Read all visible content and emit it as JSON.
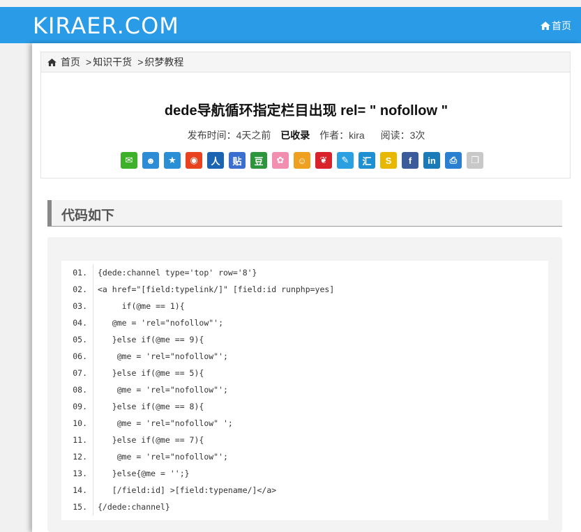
{
  "header": {
    "logo": "KIRAER.COM",
    "home_label": "首页"
  },
  "breadcrumb": {
    "home": "首页",
    "sep1": ">",
    "cat1": "知识干货",
    "sep2": ">",
    "cat2": "织梦教程"
  },
  "article": {
    "title": "dede导航循环指定栏目出现 rel= \" nofollow \"",
    "publish_label": "发布时间：",
    "publish_value": "4天之前",
    "indexed": "已收录",
    "author_label": "作者：",
    "author": "kira",
    "reads_label": "阅读：",
    "reads": "3次"
  },
  "share_icons": [
    {
      "name": "wechat-icon",
      "glyph": "✉",
      "color": "#3fb02a"
    },
    {
      "name": "qq-icon",
      "glyph": "☻",
      "color": "#2d8cd6"
    },
    {
      "name": "qzone-icon",
      "glyph": "★",
      "color": "#2a8fd4"
    },
    {
      "name": "weibo-icon",
      "glyph": "◉",
      "color": "#e8431e"
    },
    {
      "name": "renren-icon",
      "glyph": "人",
      "color": "#1b64b3"
    },
    {
      "name": "tieba-icon",
      "glyph": "贴",
      "color": "#3a6fd0"
    },
    {
      "name": "douban-icon",
      "glyph": "豆",
      "color": "#2d963c"
    },
    {
      "name": "flower-icon",
      "glyph": "✿",
      "color": "#f28fb0"
    },
    {
      "name": "kaixin-icon",
      "glyph": "☺",
      "color": "#f0a020"
    },
    {
      "name": "netease-icon",
      "glyph": "❦",
      "color": "#d8232a"
    },
    {
      "name": "edit-icon",
      "glyph": "✎",
      "color": "#2aa0e0"
    },
    {
      "name": "hui-icon",
      "glyph": "汇",
      "color": "#1e8fd0"
    },
    {
      "name": "sohu-icon",
      "glyph": "S",
      "color": "#e8b800"
    },
    {
      "name": "facebook-icon",
      "glyph": "f",
      "color": "#3b5b9a"
    },
    {
      "name": "linkedin-icon",
      "glyph": "in",
      "color": "#1a7bb8"
    },
    {
      "name": "print-icon",
      "glyph": "⎙",
      "color": "#2a7fd0"
    },
    {
      "name": "copy-icon",
      "glyph": "❐",
      "color": "#c8c8c8"
    }
  ],
  "section_title": "代码如下",
  "code_lines": [
    {
      "n": "01.",
      "t": "{dede:channel type='top' row='8'}"
    },
    {
      "n": "02.",
      "t": "<a href=\"[field:typelink/]\" [field:id runphp=yes]"
    },
    {
      "n": "03.",
      "t": "     if(@me == 1){"
    },
    {
      "n": "04.",
      "t": "   @me = 'rel=\"nofollow\"';"
    },
    {
      "n": "05.",
      "t": "   }else if(@me == 9){"
    },
    {
      "n": "06.",
      "t": "    @me = 'rel=\"nofollow\"';"
    },
    {
      "n": "07.",
      "t": "   }else if(@me == 5){"
    },
    {
      "n": "08.",
      "t": "    @me = 'rel=\"nofollow\"';"
    },
    {
      "n": "09.",
      "t": "   }else if(@me == 8){"
    },
    {
      "n": "10.",
      "t": "    @me = 'rel=\"nofollow\" ';"
    },
    {
      "n": "11.",
      "t": "   }else if(@me == 7){"
    },
    {
      "n": "12.",
      "t": "    @me = 'rel=\"nofollow\"';"
    },
    {
      "n": "13.",
      "t": "   }else{@me = '';}"
    },
    {
      "n": "14.",
      "t": "   [/field:id] >[field:typename/]</a>"
    },
    {
      "n": "15.",
      "t": "{/dede:channel}"
    }
  ]
}
